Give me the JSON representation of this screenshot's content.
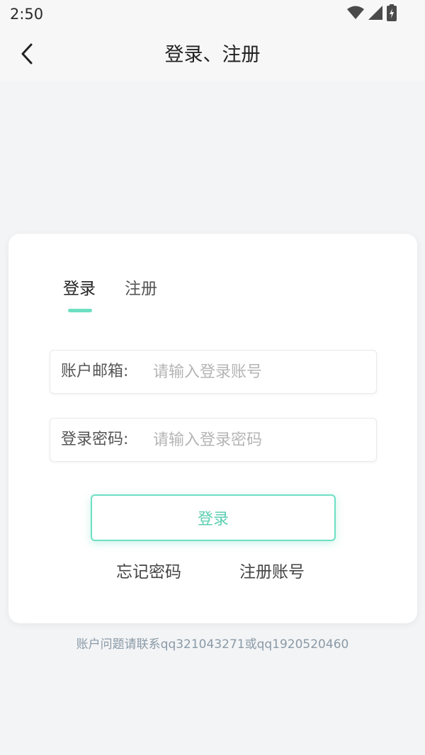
{
  "status_bar": {
    "time": "2:50"
  },
  "app_bar": {
    "title": "登录、注册"
  },
  "tabs": [
    {
      "label": "登录"
    },
    {
      "label": "注册"
    }
  ],
  "form": {
    "email": {
      "label": "账户邮箱:",
      "placeholder": "请输入登录账号",
      "value": ""
    },
    "password": {
      "label": "登录密码:",
      "placeholder": "请输入登录密码",
      "value": ""
    },
    "submit_label": "登录"
  },
  "links": {
    "forgot": "忘记密码",
    "register": "注册账号"
  },
  "footer": {
    "note": "账户问题请联系qq321043271或qq1920520460"
  },
  "colors": {
    "accent": "#6ddfc2",
    "accent_text": "#5dcfb2",
    "background": "#f3f4f6"
  }
}
